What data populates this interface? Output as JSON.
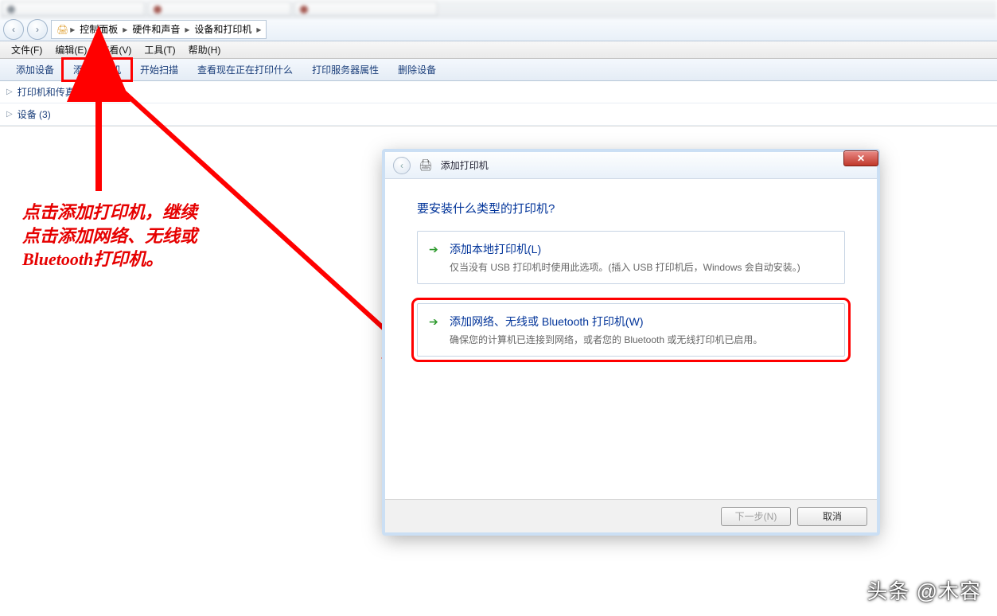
{
  "breadcrumb": {
    "p1": "控制面板",
    "p2": "硬件和声音",
    "p3": "设备和打印机"
  },
  "menu": {
    "file": "文件(F)",
    "edit": "编辑(E)",
    "view": "查看(V)",
    "tools": "工具(T)",
    "help": "帮助(H)"
  },
  "toolbar": {
    "add_device": "添加设备",
    "add_printer": "添加打印机",
    "start_scan": "开始扫描",
    "see_printing": "查看现在正在打印什么",
    "print_server_props": "打印服务器属性",
    "delete_device": "删除设备"
  },
  "groups": {
    "printers_fax": "打印机和传真 ( )",
    "devices": "设备 (3)"
  },
  "annotation": "点击添加打印机，继续\n点击添加网络、无线或\nBluetooth打印机。",
  "dialog": {
    "title": "添加打印机",
    "heading": "要安装什么类型的打印机?",
    "opt1_title": "添加本地打印机(L)",
    "opt1_desc": "仅当没有 USB 打印机时使用此选项。(插入 USB 打印机后，Windows 会自动安装。)",
    "opt2_title": "添加网络、无线或 Bluetooth 打印机(W)",
    "opt2_desc": "确保您的计算机已连接到网络，或者您的 Bluetooth 或无线打印机已启用。",
    "next": "下一步(N)",
    "cancel": "取消"
  },
  "watermark": "头条 @木容"
}
